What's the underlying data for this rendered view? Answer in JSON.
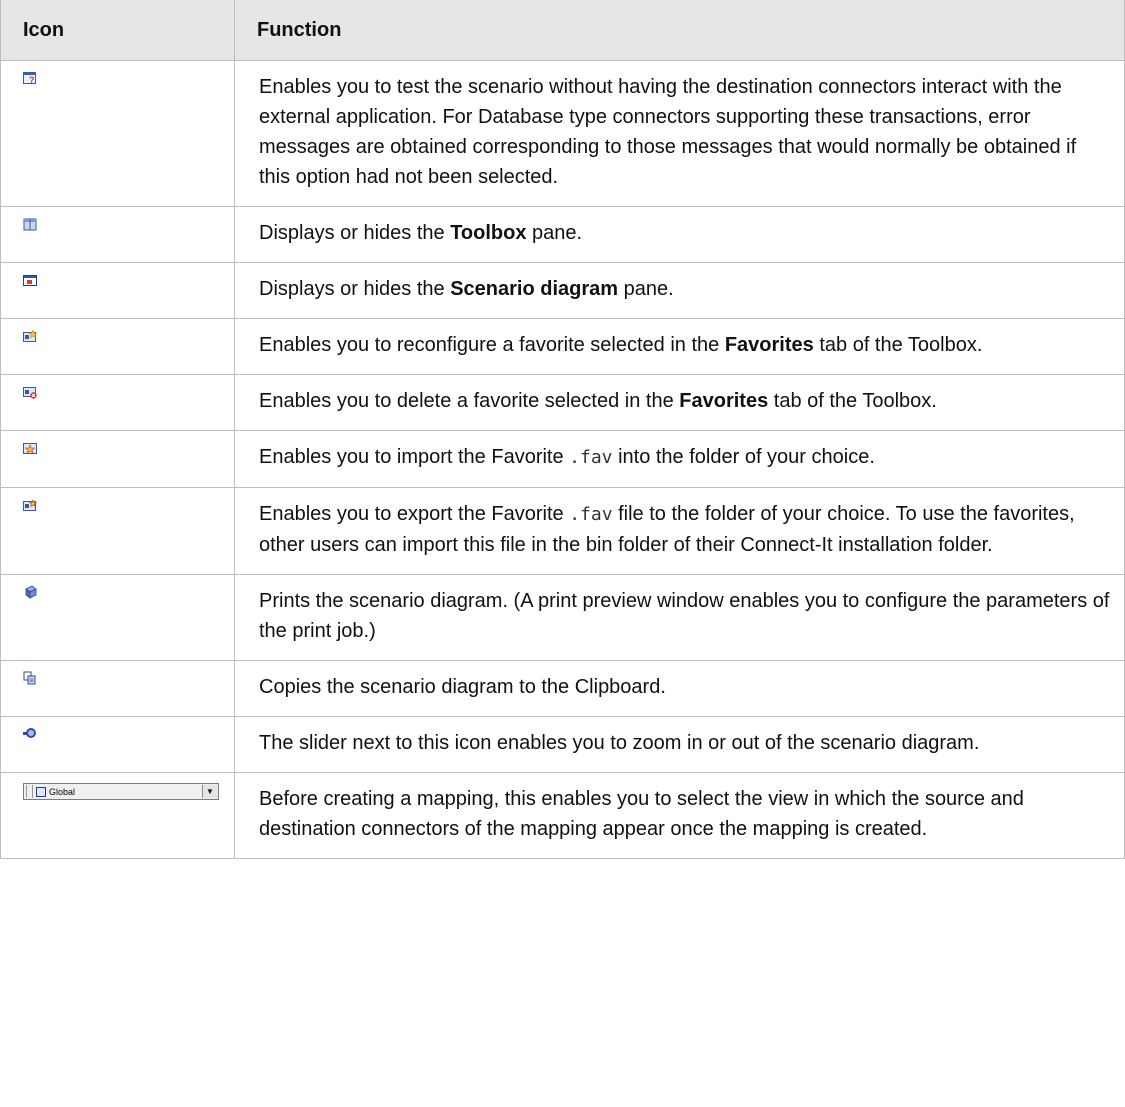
{
  "table": {
    "headers": {
      "icon": "Icon",
      "function": "Function"
    },
    "rows": {
      "r0": {
        "icon": "test-mode-icon",
        "text": "Enables you to test the scenario without having the destination connectors interact with the external application. For Database type connectors supporting these transactions, error messages are obtained corresponding to those messages that would normally be obtained if this option had not been selected."
      },
      "r1": {
        "icon": "toolbox-icon",
        "before": "Displays or hides the ",
        "bold": "Toolbox",
        "after": " pane."
      },
      "r2": {
        "icon": "scenario-diagram-icon",
        "before": "Displays or hides the ",
        "bold": "Scenario diagram",
        "after": " pane."
      },
      "r3": {
        "icon": "reconfigure-favorite-icon",
        "before": "Enables you to reconfigure a favorite selected in the ",
        "bold": "Favorites",
        "after": " tab of the Toolbox."
      },
      "r4": {
        "icon": "delete-favorite-icon",
        "before": "Enables you to delete a favorite selected in the ",
        "bold": "Favorites",
        "after": " tab of the Toolbox."
      },
      "r5": {
        "icon": "import-favorite-icon",
        "before": "Enables you to import the Favorite ",
        "code": ".fav",
        "after": " into the folder of your choice."
      },
      "r6": {
        "icon": "export-favorite-icon",
        "before": "Enables you to export the Favorite ",
        "code": ".fav",
        "after": " file to the folder of your choice. To use the favorites, other users can import this file in the bin folder of their Connect-It installation folder."
      },
      "r7": {
        "icon": "print-icon",
        "text": "Prints the scenario diagram. (A print preview window enables you to configure the parameters of the print job.)"
      },
      "r8": {
        "icon": "copy-icon",
        "text": "Copies the scenario diagram to the Clipboard."
      },
      "r9": {
        "icon": "zoom-icon",
        "text": "The slider next to this icon enables you to zoom in or out of the scenario diagram."
      },
      "r10": {
        "icon": "view-selector",
        "view_value": "Global",
        "text": "Before creating a mapping, this enables you to select the view in which the source and destination connectors of the mapping appear once the mapping is created."
      }
    }
  }
}
